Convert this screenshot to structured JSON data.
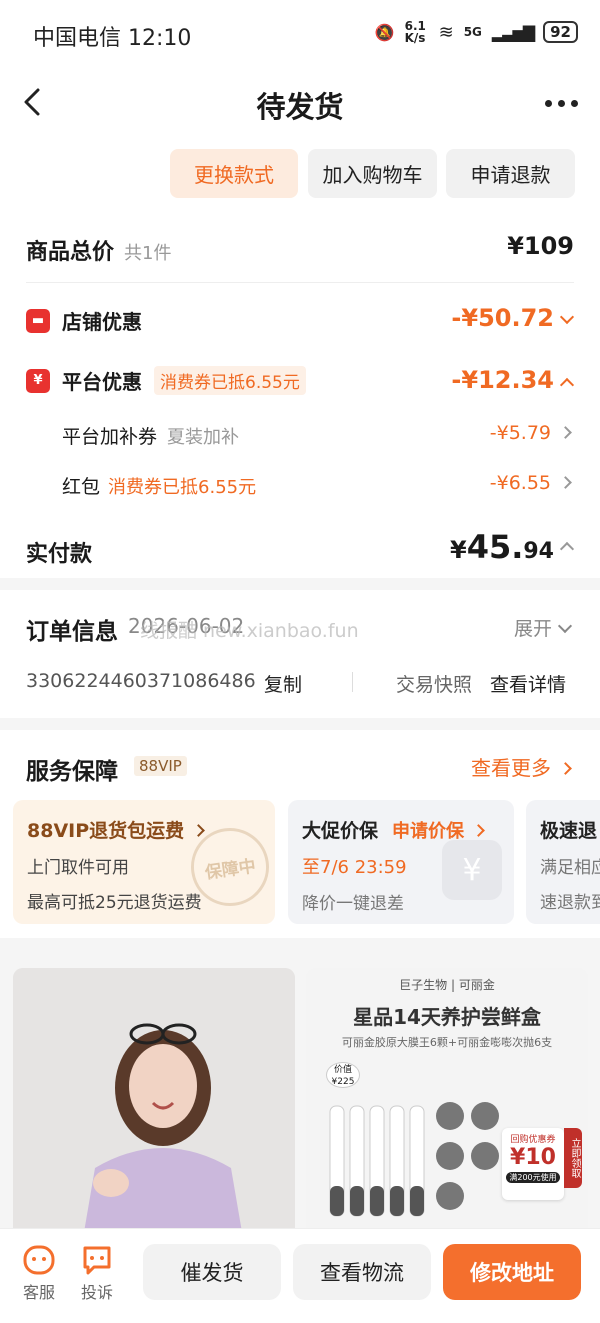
{
  "status_bar": {
    "carrier_time": "中国电信 12:10",
    "net_speed": "6.1 K/s",
    "signal": "5G",
    "battery": "92"
  },
  "header": {
    "title": "待发货"
  },
  "actions": {
    "change_style": "更换款式",
    "add_cart": "加入购物车",
    "refund": "申请退款"
  },
  "price": {
    "total_label": "商品总价",
    "count": "共1件",
    "total_value": "¥109",
    "shop_label": "店铺优惠",
    "shop_icon": "store-icon",
    "shop_value": "-¥50.72",
    "platform_label": "平台优惠",
    "platform_tag": "消费券已抵6.55元",
    "platform_value": "-¥12.34",
    "subsidy_label": "平台加补券",
    "subsidy_note": "夏装加补",
    "subsidy_value": "-¥5.79",
    "redpack_label": "红包",
    "redpack_note": "消费券已抵6.55元",
    "redpack_value": "-¥6.55",
    "paid_label": "实付款",
    "paid_currency": "¥",
    "paid_int": "45.",
    "paid_dec": "94"
  },
  "order": {
    "title": "订单信息",
    "date": "2026-06-02",
    "watermark": "线报酷 new.xianbao.fun",
    "expand": "展开",
    "number": "3306224460371086486",
    "copy": "复制",
    "snapshot": "交易快照",
    "detail": "查看详情"
  },
  "service": {
    "title": "服务保障",
    "badge": "88VIP",
    "more": "查看更多",
    "cards": [
      {
        "title": "88VIP退货包运费",
        "line1": "上门取件可用",
        "line2": "最高可抵25元退货运费",
        "stamp": "保障中"
      },
      {
        "title": "大促价保",
        "action": "申请价保",
        "line1": "至7/6 23:59",
        "line2": "降价一键退差"
      },
      {
        "title": "极速退",
        "line1": "满足相应",
        "line2": "速退款到"
      }
    ]
  },
  "feed": {
    "right": {
      "brand": "巨子生物 | 可丽金",
      "headline": "星品14天养护尝鲜盒",
      "subline": "可丽金胶原大膜王6颗+可丽金嘭嘭次抛6支",
      "value_tag": "价值¥225",
      "coupon_title": "回购优惠券",
      "coupon_value": "¥10",
      "coupon_cond": "满200元使用",
      "coupon_side": "立即领取"
    }
  },
  "bottom": {
    "service": "客服",
    "complain": "投诉",
    "urge": "催发货",
    "logistics": "查看物流",
    "address": "修改地址"
  }
}
